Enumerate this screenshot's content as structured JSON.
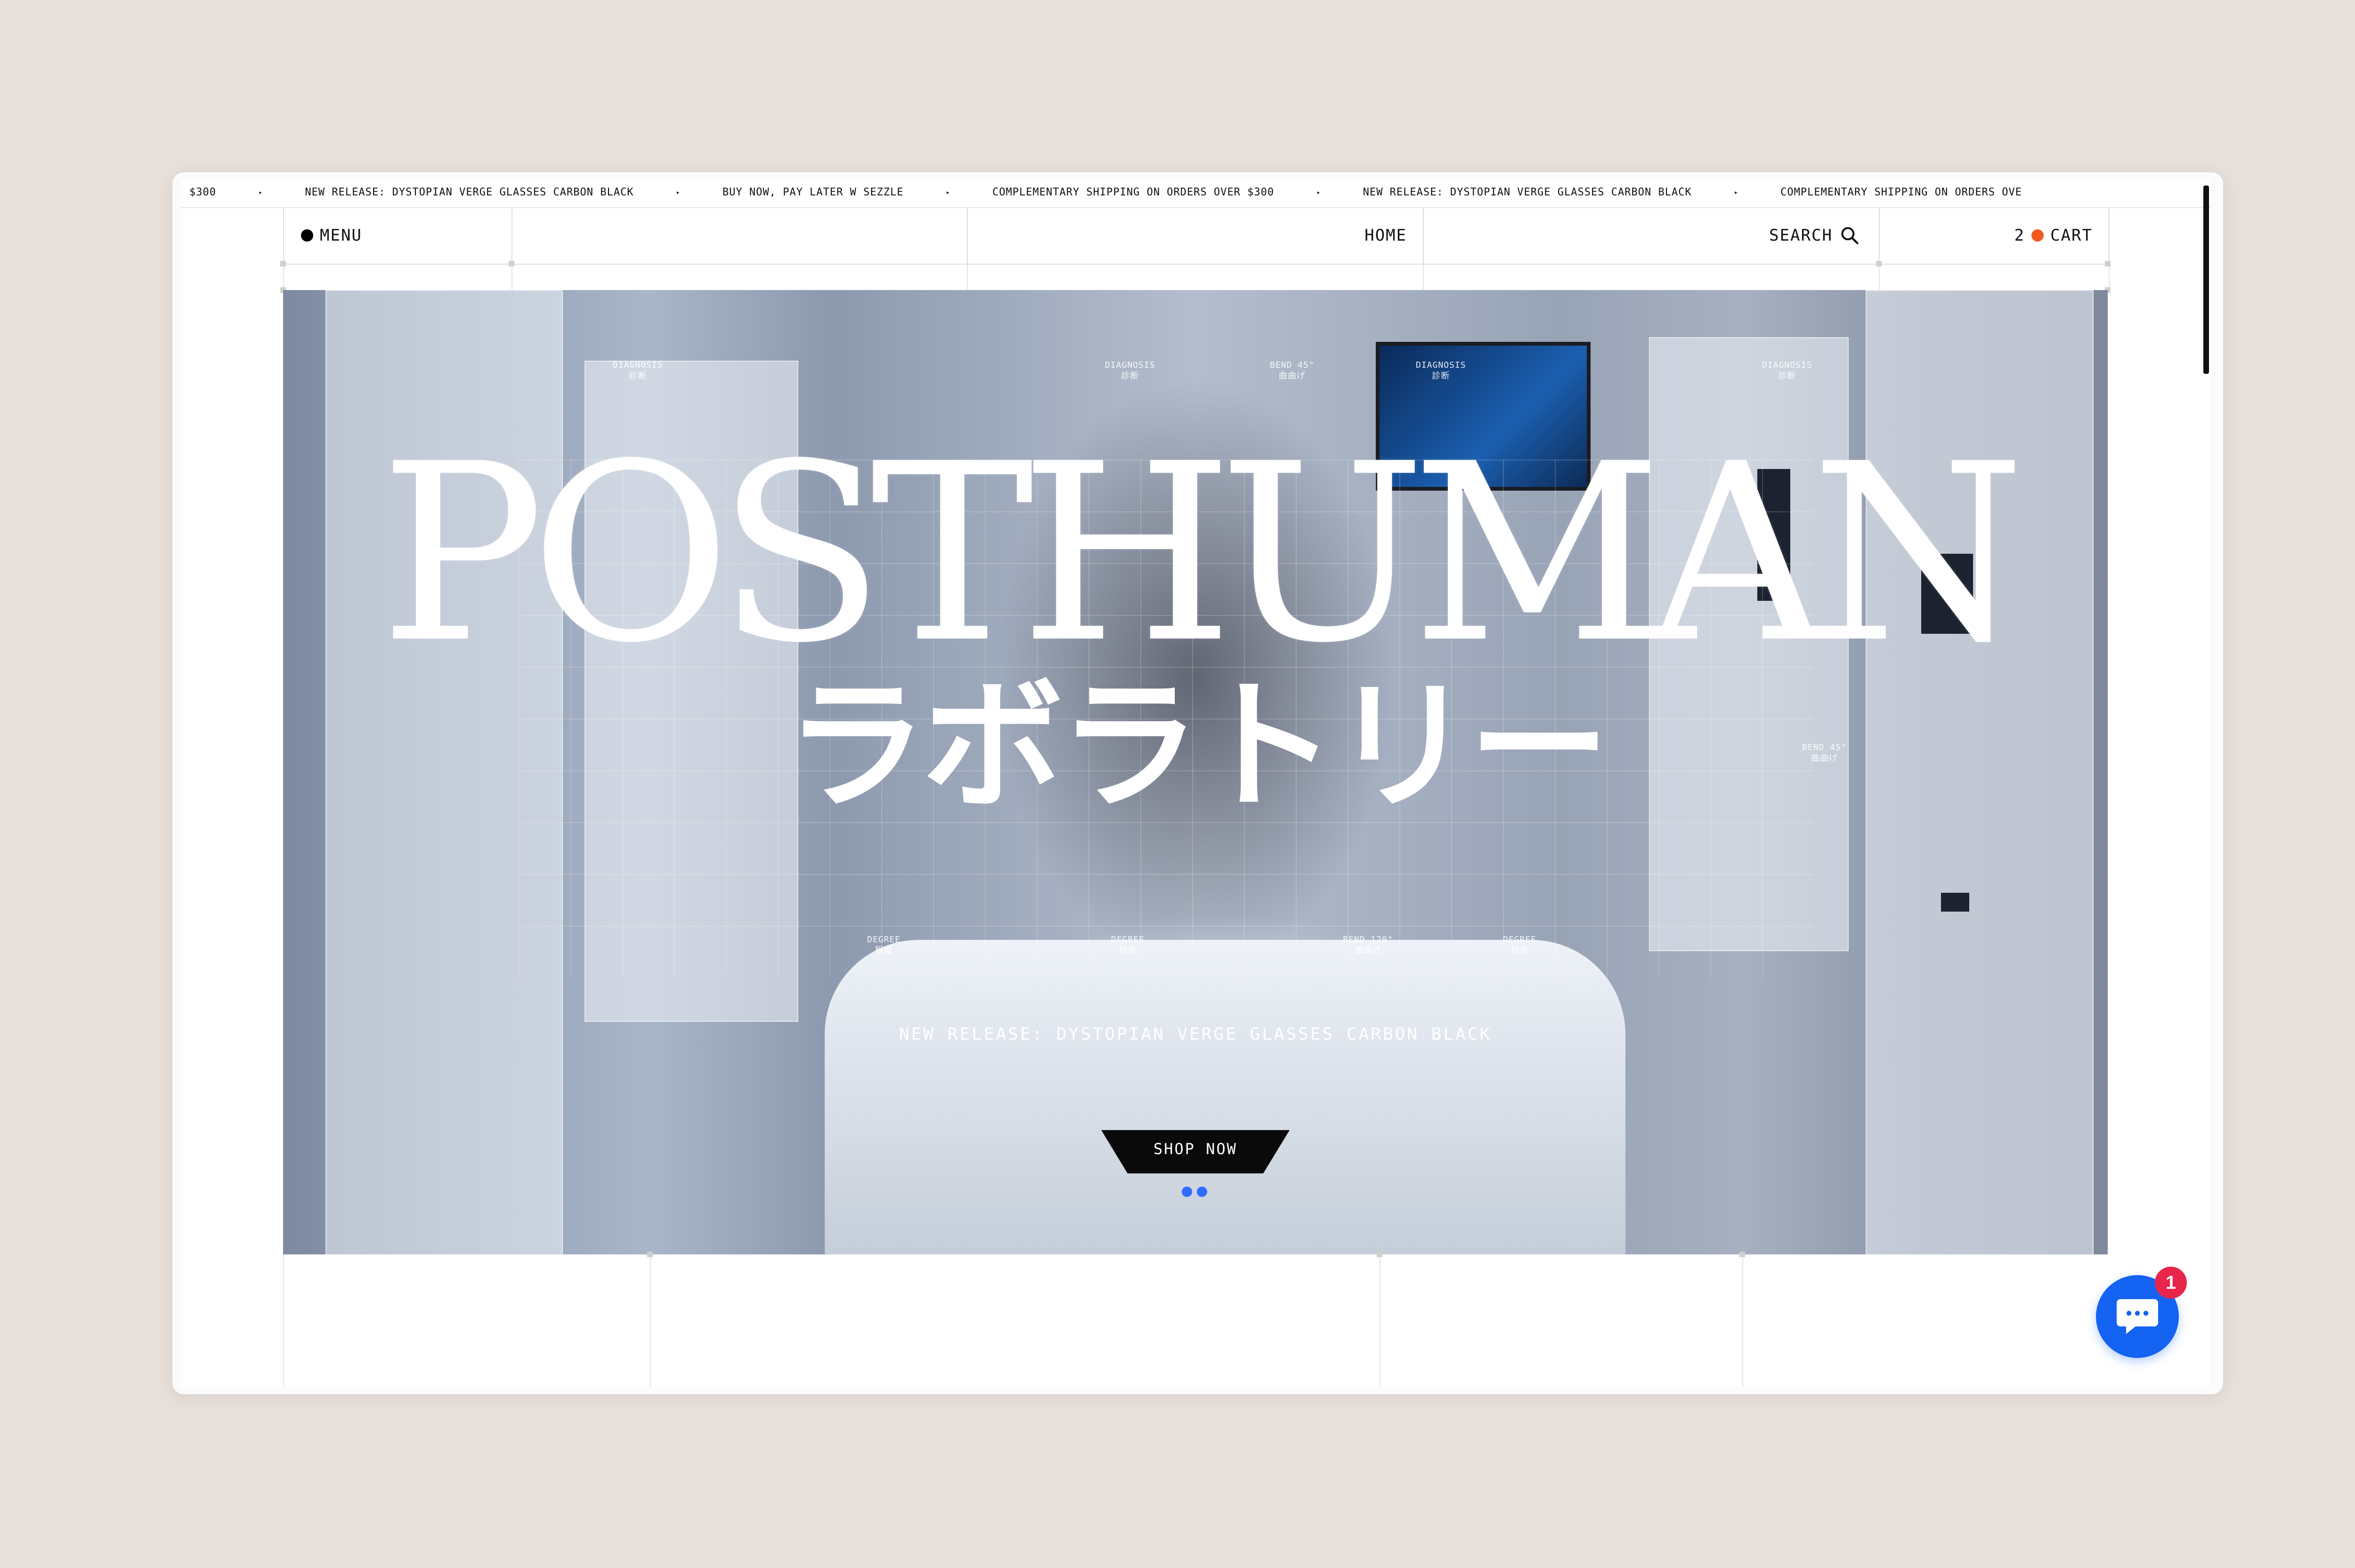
{
  "ticker": {
    "items": [
      "$300",
      "NEW RELEASE: DYSTOPIAN VERGE GLASSES CARBON BLACK",
      "BUY NOW, PAY LATER W SEZZLE",
      "COMPLEMENTARY SHIPPING ON ORDERS OVER $300",
      "NEW RELEASE: DYSTOPIAN VERGE GLASSES CARBON BLACK",
      "COMPLEMENTARY SHIPPING ON ORDERS OVE"
    ],
    "arrow": "▸"
  },
  "nav": {
    "menu_label": "MENU",
    "home_label": "HOME",
    "search_label": "SEARCH",
    "cart_count": "2",
    "cart_label": "CART"
  },
  "hero": {
    "title": "POSTHUMAN",
    "subtitle": "ラボラトリー",
    "hud_labels": [
      {
        "en": "DIAGNOSIS",
        "jp": "診断"
      },
      {
        "en": "DIAGNOSIS",
        "jp": "診断"
      },
      {
        "en": "BEND 45°",
        "jp": "曲曲げ"
      },
      {
        "en": "DIAGNOSIS",
        "jp": "診断"
      },
      {
        "en": "DIAGNOSIS",
        "jp": "診断"
      },
      {
        "en": "BEND 45°",
        "jp": "曲曲げ"
      },
      {
        "en": "DEGREE",
        "jp": "程度"
      },
      {
        "en": "DEGREE",
        "jp": "程度"
      },
      {
        "en": "BEND 120°",
        "jp": "曲曲げ"
      },
      {
        "en": "DEGREE",
        "jp": "程度"
      }
    ],
    "release_text": "NEW RELEASE: DYSTOPIAN VERGE GLASSES CARBON BLACK",
    "cta_label": "SHOP NOW",
    "slide_count": 2
  },
  "chat": {
    "badge_count": "1",
    "icon": "chat-bubble-icon"
  },
  "colors": {
    "accent_orange": "#f05a1f",
    "dot_blue": "#2f6cff",
    "chat_blue": "#1463f3",
    "badge_red": "#e8254b"
  }
}
